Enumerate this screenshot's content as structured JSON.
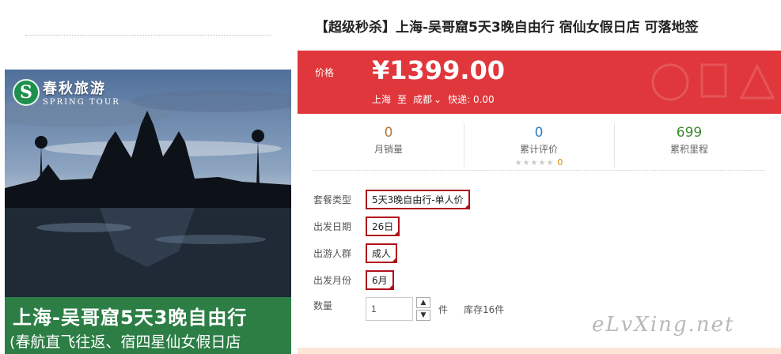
{
  "gallery": {
    "logo": {
      "cn": "春秋旅游",
      "en": "SPRING TOUR"
    },
    "banner_title": "上海-吴哥窟5天3晚自由行",
    "banner_sub": "(春航直飞往返、宿四星仙女假日店"
  },
  "product": {
    "title": "【超级秒杀】上海-吴哥窟5天3晚自由行 宿仙女假日店 可落地签",
    "price_label": "价格",
    "price": "¥1399.00",
    "origin": "上海",
    "to": "至",
    "destination": "成都",
    "delivery": "快递: 0.00"
  },
  "stats": [
    {
      "value": "0",
      "label": "月销量",
      "color": "#b07a3a"
    },
    {
      "value": "0",
      "label": "累计评价",
      "color": "#2f7fbf",
      "stars": "★★★★★",
      "star_count": "0"
    },
    {
      "value": "699",
      "label": "累积里程",
      "color": "#3c8a2e"
    }
  ],
  "options": {
    "package": {
      "label": "套餐类型",
      "value": "5天3晚自由行-单人价"
    },
    "date": {
      "label": "出发日期",
      "value": "26日"
    },
    "crowd": {
      "label": "出游人群",
      "value": "成人"
    },
    "month": {
      "label": "出发月份",
      "value": "6月"
    },
    "quantity": {
      "label": "数量",
      "value": "1",
      "unit": "件",
      "stock": "库存16件"
    }
  },
  "watermark": "eLvXing.net",
  "colors": {
    "accent": "#e0373c",
    "option_border": "#b0101a",
    "banner": "#2e8748"
  }
}
